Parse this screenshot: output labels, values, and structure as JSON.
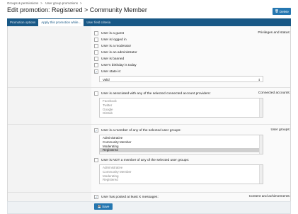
{
  "breadcrumb": [
    "Groups & permissions",
    "User group promotions"
  ],
  "page_title": "Edit promotion: Registered > Community Member",
  "delete_label": "Delete",
  "tabs": [
    "Promotion options",
    "Apply this promotion while...",
    "User field criteria"
  ],
  "privileges": {
    "label": "Privileges and status:",
    "items": [
      {
        "label": "User is a guest",
        "checked": false
      },
      {
        "label": "User is logged in",
        "checked": false
      },
      {
        "label": "User is a moderator",
        "checked": false
      },
      {
        "label": "User is an administrator",
        "checked": false
      },
      {
        "label": "User is banned",
        "checked": false
      },
      {
        "label": "User's birthday is today",
        "checked": false
      },
      {
        "label": "User state is:",
        "checked": true
      }
    ],
    "state_value": "Valid"
  },
  "connected": {
    "label": "Connected accounts:",
    "checkbox": "User is associated with any of the selected connected account providers:",
    "providers": [
      "Facebook",
      "Twitter",
      "Google",
      "GitHub"
    ]
  },
  "user_groups": {
    "label": "User groups:",
    "checkbox_any": "User is a member of any of the selected user groups:",
    "groups": [
      "Administrative",
      "Community Member",
      "Moderating",
      "Registered"
    ],
    "selected": "Registered",
    "checkbox_not": "User is NOT a member of any of the selected user groups:",
    "not_groups": [
      "Administrative",
      "Community Member",
      "Moderating",
      "Registered"
    ]
  },
  "content": {
    "label": "Content and achievements:",
    "checkbox": "User has posted at least X messages:"
  },
  "save_label": "Save",
  "colors": {
    "accent": "#185886",
    "button": "#2577b1"
  }
}
